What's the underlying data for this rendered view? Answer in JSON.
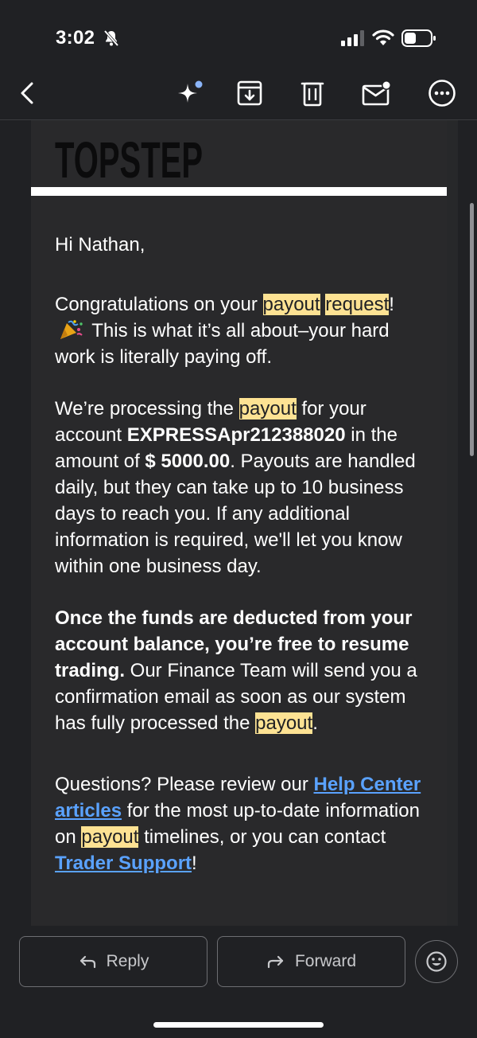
{
  "status_bar": {
    "time": "3:02"
  },
  "toolbar": {
    "back_icon": "chevron-left-icon",
    "ai_icon": "sparkle-icon",
    "archive_icon": "archive-icon",
    "delete_icon": "trash-icon",
    "unread_icon": "mark-unread-icon",
    "more_icon": "more-icon"
  },
  "email": {
    "brand": "TOPSTEP",
    "greeting": "Hi Nathan,",
    "p1": {
      "pre": "Congratulations on your ",
      "hl1": "payout",
      "space": " ",
      "hl2": "request",
      "mid": "! ",
      "post": " This is what it’s all about–your hard work is literally paying off."
    },
    "p2": {
      "pre": "We’re processing the ",
      "hl": "payout",
      "mid": " for your account ",
      "account": "EXPRESSApr212388020",
      "mid2": " in the amount of ",
      "amount": "$ 5000.00",
      "post": ". Payouts are handled daily, but they can take up to 10 business days to reach you. If any additional information is required, we'll let you know within one business day."
    },
    "p3": {
      "bold": "Once the funds are deducted from your account balance, you’re free to resume trading.",
      "post": " Our Finance Team will send you a confirmation email as soon as our system has fully processed the ",
      "hl": "payout",
      "end": "."
    },
    "p4": {
      "pre": "Questions? Please review our ",
      "link1": "Help Center articles",
      "mid": " for the most up-to-date information on ",
      "hl": "payout",
      "mid2": " timelines, or you can contact ",
      "link2": "Trader Support",
      "end": "!"
    }
  },
  "actions": {
    "reply": "Reply",
    "forward": "Forward"
  },
  "colors": {
    "background": "#202124",
    "highlight": "#fde293",
    "link": "#5aa2ff"
  }
}
